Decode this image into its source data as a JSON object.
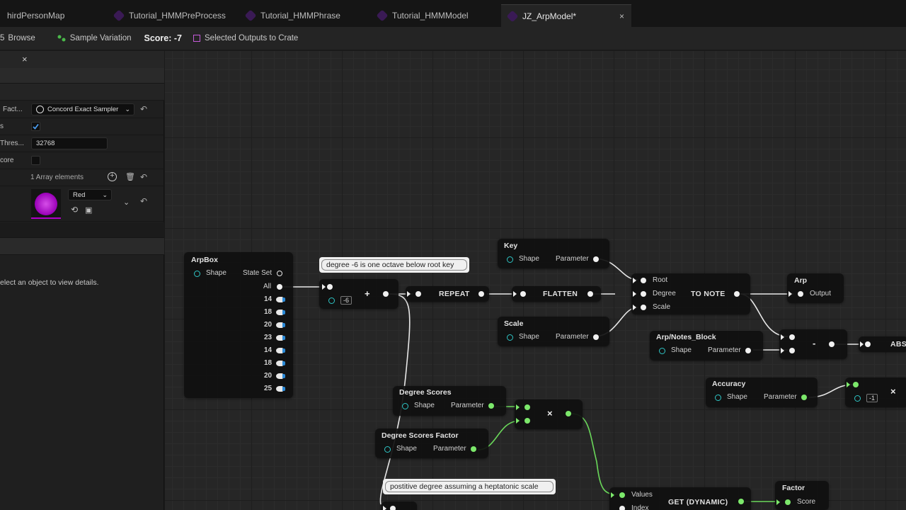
{
  "tabs": [
    {
      "label": "hirdPersonMap",
      "active": false
    },
    {
      "label": "Tutorial_HMMPreProcess",
      "active": false
    },
    {
      "label": "Tutorial_HMMPhrase",
      "active": false
    },
    {
      "label": "Tutorial_HMMModel",
      "active": false
    },
    {
      "label": "JZ_ArpModel*",
      "active": true
    }
  ],
  "tab_close": "×",
  "toolbar": {
    "browse_prefix": "5",
    "browse": "Browse",
    "sample_variation": "Sample Variation",
    "score": "Score: -7",
    "selected_outputs": "Selected Outputs to Crate"
  },
  "details": {
    "close": "×",
    "rows": {
      "fact_label": "Fact...",
      "fact_value": "Concord Exact Sampler",
      "s_label": "s",
      "thres_label": "Thres...",
      "thres_value": "32768",
      "core_label": "core",
      "array_elements": "1 Array elements",
      "color_value": "Red"
    },
    "select_hint": "elect an object to view details."
  },
  "graph": {
    "arpbox": {
      "title": "ArpBox",
      "shape": "Shape",
      "state_set": "State Set",
      "all": "All",
      "outputs": [
        "14",
        "18",
        "20",
        "23",
        "14",
        "18",
        "20",
        "25"
      ]
    },
    "comment1": "degree -6 is one octave below root key",
    "comment2": "postitive degree assuming a heptatonic scale",
    "add_const": "-6",
    "plus": "+",
    "repeat": "REPEAT",
    "flatten": "FLATTEN",
    "key": {
      "title": "Key",
      "shape": "Shape",
      "param": "Parameter"
    },
    "scale": {
      "title": "Scale",
      "shape": "Shape",
      "param": "Parameter"
    },
    "tonote": {
      "title": "TO NOTE",
      "root": "Root",
      "degree": "Degree",
      "scale": "Scale"
    },
    "arp": {
      "title": "Arp",
      "output": "Output"
    },
    "notes_block": {
      "title": "Arp/Notes_Block",
      "shape": "Shape",
      "param": "Parameter"
    },
    "minus": "-",
    "abs": "ABS",
    "accuracy": {
      "title": "Accuracy",
      "shape": "Shape",
      "param": "Parameter"
    },
    "mul_const": "-1",
    "times": "×",
    "degree_scores": {
      "title": "Degree Scores",
      "shape": "Shape",
      "param": "Parameter"
    },
    "degree_scores_factor": {
      "title": "Degree Scores Factor",
      "shape": "Shape",
      "param": "Parameter"
    },
    "get_dynamic": {
      "title": "GET (DYNAMIC)",
      "values": "Values",
      "index": "Index"
    },
    "factor": {
      "title": "Factor",
      "score": "Score"
    }
  },
  "colors": {
    "accent_teal": "#2ec5c5",
    "pin_green": "#7ce86b",
    "color_swatch": "#b000c8"
  }
}
